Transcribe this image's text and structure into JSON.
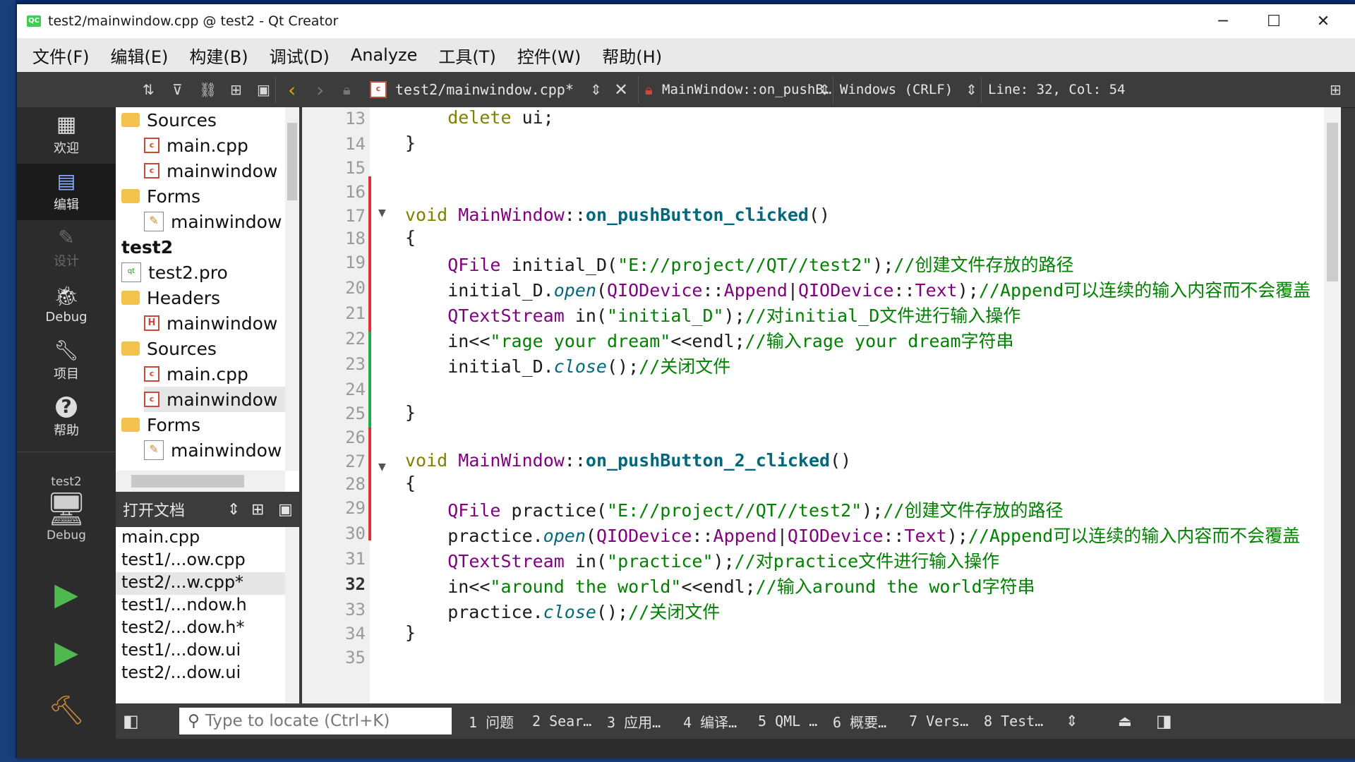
{
  "window": {
    "title": "test2/mainwindow.cpp @ test2 - Qt Creator",
    "app_icon": "QC"
  },
  "controls": {
    "minimize": "─",
    "maximize": "☐",
    "close": "✕"
  },
  "menu": [
    "文件(F)",
    "编辑(E)",
    "构建(B)",
    "调试(D)",
    "Analyze",
    "工具(T)",
    "控件(W)",
    "帮助(H)"
  ],
  "toolbar": {
    "file": "test2/mainwindow.cpp*",
    "symbol": "MainWindow::on_pushB…",
    "encoding": "Windows (CRLF)",
    "position": "Line: 32, Col: 54"
  },
  "modes": [
    {
      "label": "欢迎",
      "icon": "grid-icon"
    },
    {
      "label": "编辑",
      "icon": "edit-icon"
    },
    {
      "label": "设计",
      "icon": "pencil-icon"
    },
    {
      "label": "Debug",
      "icon": "bug-icon"
    },
    {
      "label": "项目",
      "icon": "wrench-icon"
    },
    {
      "label": "帮助",
      "icon": "help-icon"
    }
  ],
  "kit": {
    "project": "test2",
    "config": "Debug"
  },
  "tree": [
    {
      "label": "Sources",
      "kind": "folder",
      "level": 0
    },
    {
      "label": "main.cpp",
      "kind": "cpp",
      "level": 1
    },
    {
      "label": "mainwindow",
      "kind": "cpp",
      "level": 1
    },
    {
      "label": "Forms",
      "kind": "folder",
      "level": 0
    },
    {
      "label": "mainwindow",
      "kind": "ui",
      "level": 1
    },
    {
      "label": "test2",
      "kind": "project",
      "level": -1
    },
    {
      "label": "test2.pro",
      "kind": "pro",
      "level": 0
    },
    {
      "label": "Headers",
      "kind": "folder",
      "level": 0
    },
    {
      "label": "mainwindow",
      "kind": "h",
      "level": 1
    },
    {
      "label": "Sources",
      "kind": "folder",
      "level": 0
    },
    {
      "label": "main.cpp",
      "kind": "cpp",
      "level": 1
    },
    {
      "label": "mainwindow",
      "kind": "cpp",
      "level": 1,
      "selected": true
    },
    {
      "label": "Forms",
      "kind": "folder",
      "level": 0
    },
    {
      "label": "mainwindow",
      "kind": "ui",
      "level": 1
    }
  ],
  "open_docs": {
    "header": "打开文档",
    "items": [
      "main.cpp",
      "test1/...ow.cpp",
      "test2/...w.cpp*",
      "test1/...ndow.h",
      "test2/...dow.h*",
      "test1/...dow.ui",
      "test2/...dow.ui"
    ]
  },
  "editor": {
    "lines": [
      {
        "n": "13",
        "html": "    <span class='kw'>delete</span> ui;"
      },
      {
        "n": "14",
        "html": "}"
      },
      {
        "n": "15",
        "html": ""
      },
      {
        "n": "16",
        "html": ""
      },
      {
        "n": "17",
        "html": "<span class='kw'>void</span> <span class='ty'>MainWindow</span>::<span class='fn'>on_pushButton_clicked</span>()"
      },
      {
        "n": "18",
        "html": "{"
      },
      {
        "n": "19",
        "html": "    <span class='ty'>QFile</span> initial_D(<span class='str'>\"E://project//QT//test2\"</span>);<span class='cm'>//创建文件存放的路径</span>"
      },
      {
        "n": "20",
        "html": "    initial_D.<span class='it'>open</span>(<span class='ty'>QIODevice</span>::<span class='ty'>Append</span>|<span class='ty'>QIODevice</span>::<span class='ty'>Text</span>);<span class='cm'>//Append可以连续的输入内容而不会覆盖</span>"
      },
      {
        "n": "21",
        "html": "    <span class='ty'>QTextStream</span> in(<span class='str'>\"initial_D\"</span>);<span class='cm'>//对initial_D文件进行输入操作</span>"
      },
      {
        "n": "22",
        "html": "    in&lt;&lt;<span class='str'>\"rage your dream\"</span>&lt;&lt;endl;<span class='cm'>//输入rage your dream字符串</span>"
      },
      {
        "n": "23",
        "html": "    initial_D.<span class='it'>close</span>();<span class='cm'>//关闭文件</span>"
      },
      {
        "n": "24",
        "html": ""
      },
      {
        "n": "25",
        "html": "}"
      },
      {
        "n": "26",
        "html": ""
      },
      {
        "n": "27",
        "html": "<span class='kw'>void</span> <span class='ty'>MainWindow</span>::<span class='fn'>on_pushButton_2_clicked</span>()"
      },
      {
        "n": "28",
        "html": "{"
      },
      {
        "n": "29",
        "html": "    <span class='ty'>QFile</span> practice(<span class='str'>\"E://project//QT//test2\"</span>);<span class='cm'>//创建文件存放的路径</span>"
      },
      {
        "n": "30",
        "html": "    practice.<span class='it'>open</span>(<span class='ty'>QIODevice</span>::<span class='ty'>Append</span>|<span class='ty'>QIODevice</span>::<span class='ty'>Text</span>);<span class='cm'>//Append可以连续的输入内容而不会覆盖</span>"
      },
      {
        "n": "31",
        "html": "    <span class='ty'>QTextStream</span> in(<span class='str'>\"practice\"</span>);<span class='cm'>//对practice文件进行输入操作</span>"
      },
      {
        "n": "32",
        "html": "    in&lt;&lt;<span class='str'>\"around the world\"</span>&lt;&lt;endl;<span class='cm'>//输入around the world字符串</span>"
      },
      {
        "n": "33",
        "html": "    practice.<span class='it'>close</span>();<span class='cm'>//关闭文件</span>"
      },
      {
        "n": "34",
        "html": "}"
      },
      {
        "n": "35",
        "html": ""
      }
    ],
    "current_line": "32"
  },
  "status": {
    "locate_placeholder": "Type to locate (Ctrl+K)",
    "tabs": [
      "1 问题",
      "2 Sear…",
      "3 应用…",
      "4 编译…",
      "5 QML …",
      "6 概要…",
      "7 Vers…",
      "8 Test…"
    ]
  }
}
